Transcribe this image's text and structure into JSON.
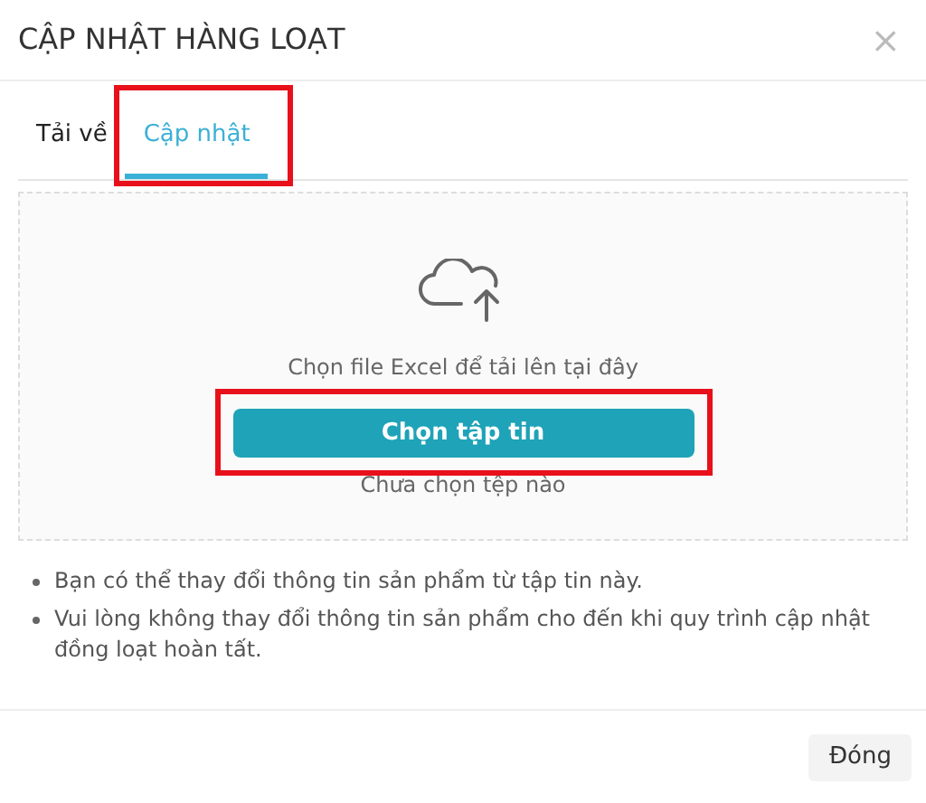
{
  "dialog": {
    "title": "CẬP NHẬT HÀNG LOẠT",
    "close": "×"
  },
  "tabs": [
    {
      "label": "Tải về",
      "selected": false,
      "highlighted": false
    },
    {
      "label": "Cập nhật",
      "selected": true,
      "highlighted": true
    }
  ],
  "dropzone": {
    "hint": "Chọn file Excel để tải lên tại đây",
    "button": {
      "label": "Chọn tập tin",
      "highlighted": true
    },
    "status": "Chưa chọn tệp nào"
  },
  "notes": [
    "Bạn có thể thay đổi thông tin sản phẩm từ tập tin này.",
    "Vui lòng không thay đổi thông tin sản phẩm cho đến khi quy trình cập nhật đồng loạt hoàn tất."
  ],
  "footer": {
    "close_button": "Đóng"
  }
}
